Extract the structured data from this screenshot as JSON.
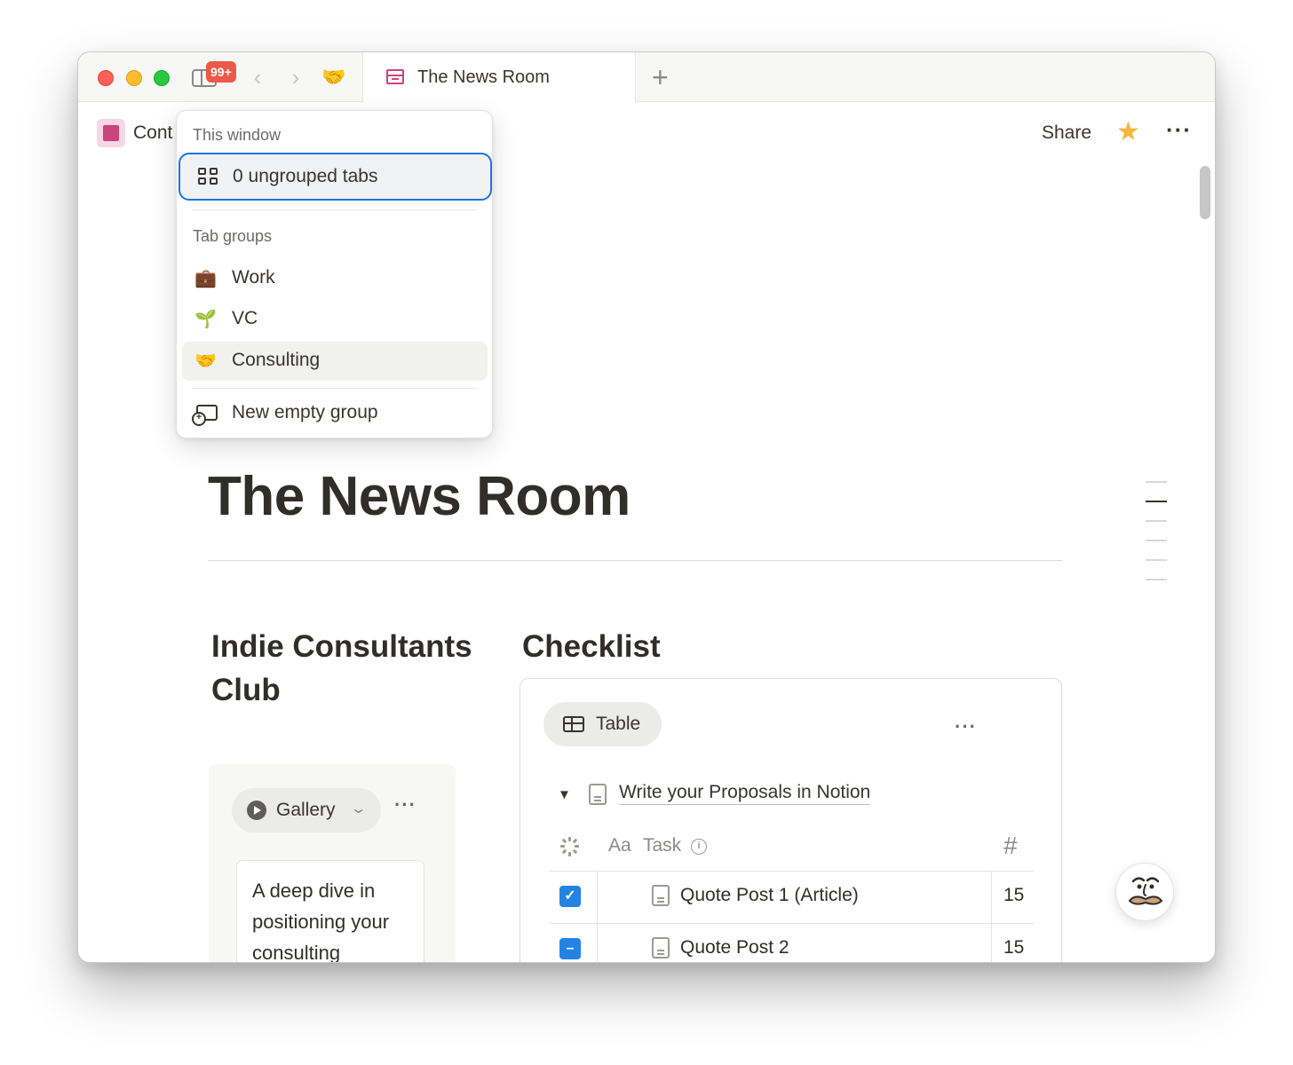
{
  "browser": {
    "tab_count_badge": "99+",
    "back_glyph": "‹",
    "forward_glyph": "›",
    "pinned_group_emoji": "🤝",
    "active_tab_title": "The News Room",
    "new_tab_glyph": "+"
  },
  "topbar": {
    "breadcrumb": "Cont",
    "share_label": "Share",
    "favorite_glyph": "★",
    "more_glyph": "···"
  },
  "tab_menu": {
    "this_window_heading": "This window",
    "ungrouped_label": "0 ungrouped tabs",
    "tab_groups_heading": "Tab groups",
    "groups": [
      {
        "emoji": "💼",
        "label": "Work"
      },
      {
        "emoji": "🌱",
        "label": "VC"
      },
      {
        "emoji": "🤝",
        "label": "Consulting"
      }
    ],
    "new_group_label": "New empty group"
  },
  "page": {
    "title": "The News Room",
    "left_column": {
      "heading": "Indie Consultants Club",
      "view_label": "Gallery",
      "chevron_glyph": "⌄",
      "more_glyph": "···",
      "card_text": "A deep dive in positioning your consulting"
    },
    "right_column": {
      "heading": "Checklist",
      "view_label": "Table",
      "more_glyph": "···",
      "group_caret": "▼",
      "group_title": "Write your Proposals in Notion",
      "columns": {
        "title_type_glyph": "Aa",
        "title": "Task",
        "info_glyph": "i",
        "number": "#"
      },
      "rows": [
        {
          "checkbox_glyph": "✓",
          "title": "Quote Post 1 (Article)",
          "number": "15"
        },
        {
          "checkbox_glyph": "–",
          "title": "Quote Post 2",
          "number": "15"
        }
      ]
    }
  },
  "colors": {
    "accent_blue": "#1a73e8",
    "checkbox_blue": "#2383e2",
    "page_icon_pink": "#c9457a",
    "badge_red": "#eb5a46",
    "star_yellow": "#f5b73b"
  }
}
